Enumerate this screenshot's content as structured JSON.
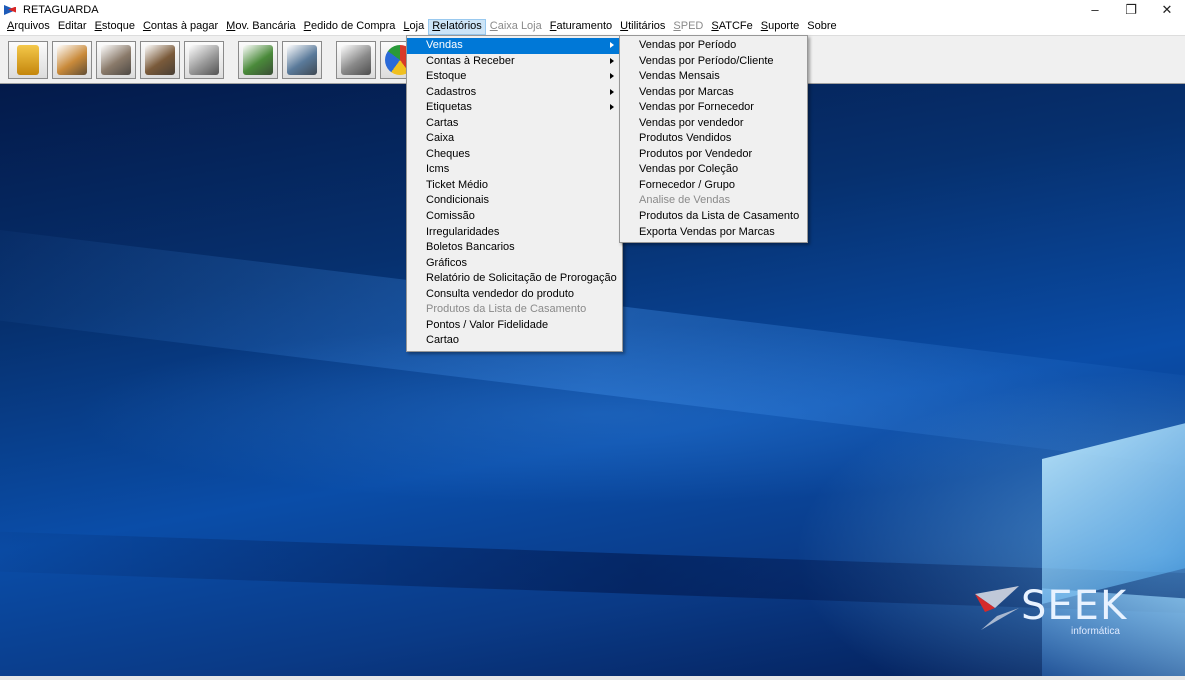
{
  "window": {
    "title": "RETAGUARDA",
    "controls": {
      "minimize": "–",
      "restore": "❐",
      "close": "✕"
    }
  },
  "menubar": [
    {
      "label": "Arquivos",
      "ul": "A",
      "rest": "rquivos",
      "disabled": false
    },
    {
      "label": "Editar",
      "ul": "",
      "rest": "Editar",
      "disabled": false
    },
    {
      "label": "Estoque",
      "ul": "E",
      "rest": "stoque",
      "disabled": false
    },
    {
      "label": "Contas à pagar",
      "ul": "C",
      "rest": "ontas à pagar",
      "disabled": false
    },
    {
      "label": "Mov. Bancária",
      "ul": "M",
      "rest": "ov. Bancária",
      "disabled": false
    },
    {
      "label": "Pedido de Compra",
      "ul": "P",
      "rest": "edido de Compra",
      "disabled": false
    },
    {
      "label": "Loja",
      "ul": "L",
      "rest": "oja",
      "disabled": false
    },
    {
      "label": "Relatórios",
      "ul": "R",
      "rest": "elatórios",
      "disabled": false,
      "active": true
    },
    {
      "label": "Caixa Loja",
      "ul": "C",
      "rest": "aixa Loja",
      "disabled": true
    },
    {
      "label": "Faturamento",
      "ul": "F",
      "rest": "aturamento",
      "disabled": false
    },
    {
      "label": "Utilitários",
      "ul": "U",
      "rest": "tilitários",
      "disabled": false
    },
    {
      "label": "SPED",
      "ul": "S",
      "rest": "PED",
      "disabled": true
    },
    {
      "label": "SATCFe",
      "ul": "S",
      "rest": "ATCFe",
      "disabled": false
    },
    {
      "label": "Suporte",
      "ul": "S",
      "rest": "uporte",
      "disabled": false
    },
    {
      "label": "Sobre",
      "ul": "",
      "rest": "Sobre",
      "disabled": false
    }
  ],
  "toolbar": [
    {
      "icon": "padlock-icon",
      "color": "#e0a21a"
    },
    {
      "icon": "box-icon",
      "color": "#c98a3a"
    },
    {
      "icon": "scale-box-icon",
      "color": "#8a7a6a"
    },
    {
      "icon": "delivery-icon",
      "color": "#7a5a3a"
    },
    {
      "icon": "printer-icon",
      "color": "#9a9a9a"
    },
    {
      "icon": "people-icon",
      "color": "#4a8a3a",
      "gap": true
    },
    {
      "icon": "people-scan-icon",
      "color": "#5a7a9a"
    },
    {
      "icon": "cash-register-icon",
      "color": "#8a8a8a",
      "gap": true
    },
    {
      "icon": "pie-chart-icon",
      "color": "#d83a2a"
    }
  ],
  "relatorios_menu": [
    {
      "label": "Vendas",
      "submenu": true,
      "selected": true
    },
    {
      "label": "Contas à Receber",
      "submenu": true
    },
    {
      "label": "Estoque",
      "submenu": true
    },
    {
      "label": "Cadastros",
      "submenu": true
    },
    {
      "label": "Etiquetas",
      "submenu": true
    },
    {
      "label": "Cartas"
    },
    {
      "label": "Caixa"
    },
    {
      "label": "Cheques"
    },
    {
      "label": "Icms"
    },
    {
      "label": "Ticket Médio"
    },
    {
      "label": "Condicionais"
    },
    {
      "label": "Comissão"
    },
    {
      "label": "Irregularidades"
    },
    {
      "label": "Boletos Bancarios"
    },
    {
      "label": "Gráficos"
    },
    {
      "label": "Relatório de Solicitação de Prorogação"
    },
    {
      "label": "Consulta vendedor do produto"
    },
    {
      "label": "Produtos da Lista de Casamento",
      "disabled": true
    },
    {
      "label": "Pontos / Valor Fidelidade"
    },
    {
      "label": "Cartao"
    }
  ],
  "vendas_submenu": [
    {
      "label": "Vendas por Período"
    },
    {
      "label": "Vendas por Período/Cliente"
    },
    {
      "label": "Vendas Mensais"
    },
    {
      "label": "Vendas por Marcas"
    },
    {
      "label": "Vendas por Fornecedor"
    },
    {
      "label": "Vendas por vendedor"
    },
    {
      "label": "Produtos Vendidos"
    },
    {
      "label": "Produtos por Vendedor"
    },
    {
      "label": "Vendas por Coleção"
    },
    {
      "label": "Fornecedor / Grupo"
    },
    {
      "label": "Analise de Vendas",
      "disabled": true
    },
    {
      "label": "Produtos da Lista de Casamento"
    },
    {
      "label": "Exporta Vendas por Marcas"
    }
  ],
  "logo": {
    "name": "SEEK",
    "sub": "informática"
  }
}
